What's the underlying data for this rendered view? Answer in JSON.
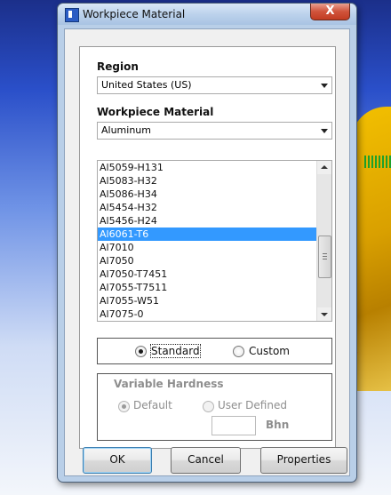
{
  "dialog": {
    "title": "Workpiece Material",
    "close_glyph": "X"
  },
  "region": {
    "label": "Region",
    "selected": "United States (US)"
  },
  "material": {
    "label": "Workpiece Material",
    "selected": "Aluminum"
  },
  "materials_list": {
    "items": [
      "Al5059-H131",
      "Al5083-H32",
      "Al5086-H34",
      "Al5454-H32",
      "Al5456-H24",
      "Al6061-T6",
      "Al7010",
      "Al7050",
      "Al7050-T7451",
      "Al7055-T7511",
      "Al7055-W51",
      "Al7075-0"
    ],
    "selected_index": 5
  },
  "mode": {
    "standard_label": "Standard",
    "custom_label": "Custom",
    "selected": "Standard"
  },
  "hardness": {
    "title": "Variable Hardness",
    "default_label": "Default",
    "user_defined_label": "User Defined",
    "value": "",
    "unit": "Bhn",
    "selected": "Default",
    "enabled": false
  },
  "buttons": {
    "ok": "OK",
    "cancel": "Cancel",
    "properties": "Properties"
  },
  "icons": {
    "app": "app-icon",
    "close": "close-icon"
  }
}
